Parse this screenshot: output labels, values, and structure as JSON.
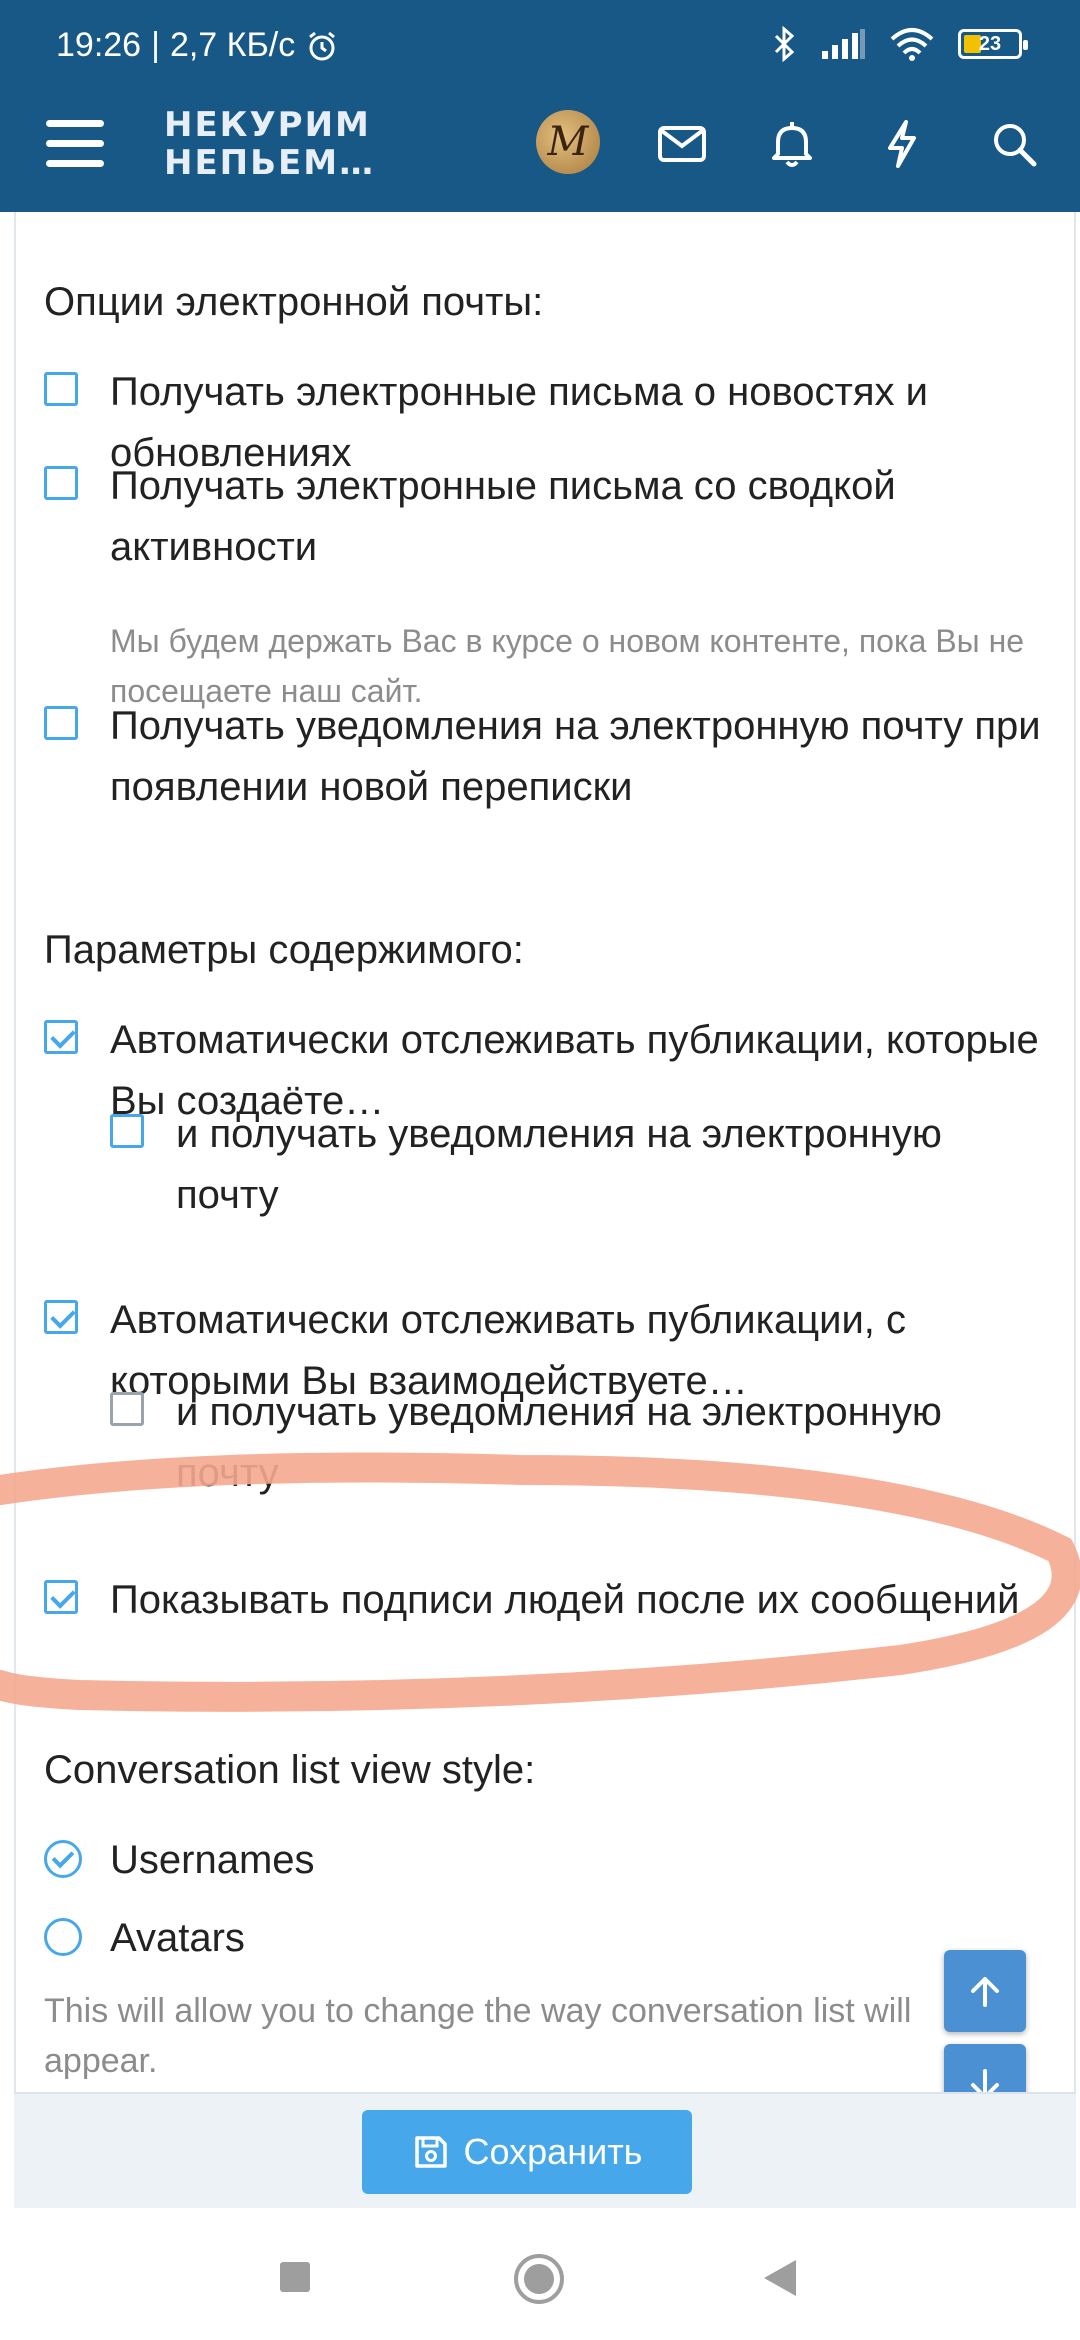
{
  "status_bar": {
    "time": "19:26",
    "speed": "2,7 КБ/с",
    "battery": "23"
  },
  "header": {
    "logo_line1": "НЕКУРИМ",
    "logo_line2": "НЕПЬЕМ…",
    "avatar_letter": "M"
  },
  "email_section": {
    "title": "Опции электронной почты:",
    "options": [
      {
        "label": "Получать электронные письма о новостях и обновлениях",
        "checked": false
      },
      {
        "label": "Получать электронные письма со сводкой активности",
        "checked": false,
        "hint": "Мы будем держать Вас в курсе о новом контенте, пока Вы не посещаете наш сайт."
      },
      {
        "label": "Получать уведомления на электронную почту при появлении новой переписки",
        "checked": false
      }
    ]
  },
  "content_section": {
    "title": "Параметры содержимого:",
    "options": [
      {
        "label": "Автоматически отслеживать публикации, которые Вы создаёте…",
        "checked": true
      },
      {
        "label": "и получать уведомления на электронную почту",
        "checked": false
      },
      {
        "label": "Автоматически отслеживать публикации, с которыми Вы взаимодействуете…",
        "checked": true
      },
      {
        "label": "и получать уведомления на электронную почту",
        "checked": false
      },
      {
        "label": "Показывать подписи людей после их сообщений",
        "checked": true
      }
    ]
  },
  "conversation_section": {
    "title": "Conversation list view style:",
    "options": [
      {
        "label": "Usernames",
        "selected": true
      },
      {
        "label": "Avatars",
        "selected": false
      }
    ],
    "hint": "This will allow you to change the way conversation list will appear."
  },
  "footer": {
    "save_label": "Сохранить"
  },
  "colors": {
    "header": "#185886",
    "accent": "#47a7eb",
    "highlight_stroke": "#f4a98f"
  }
}
